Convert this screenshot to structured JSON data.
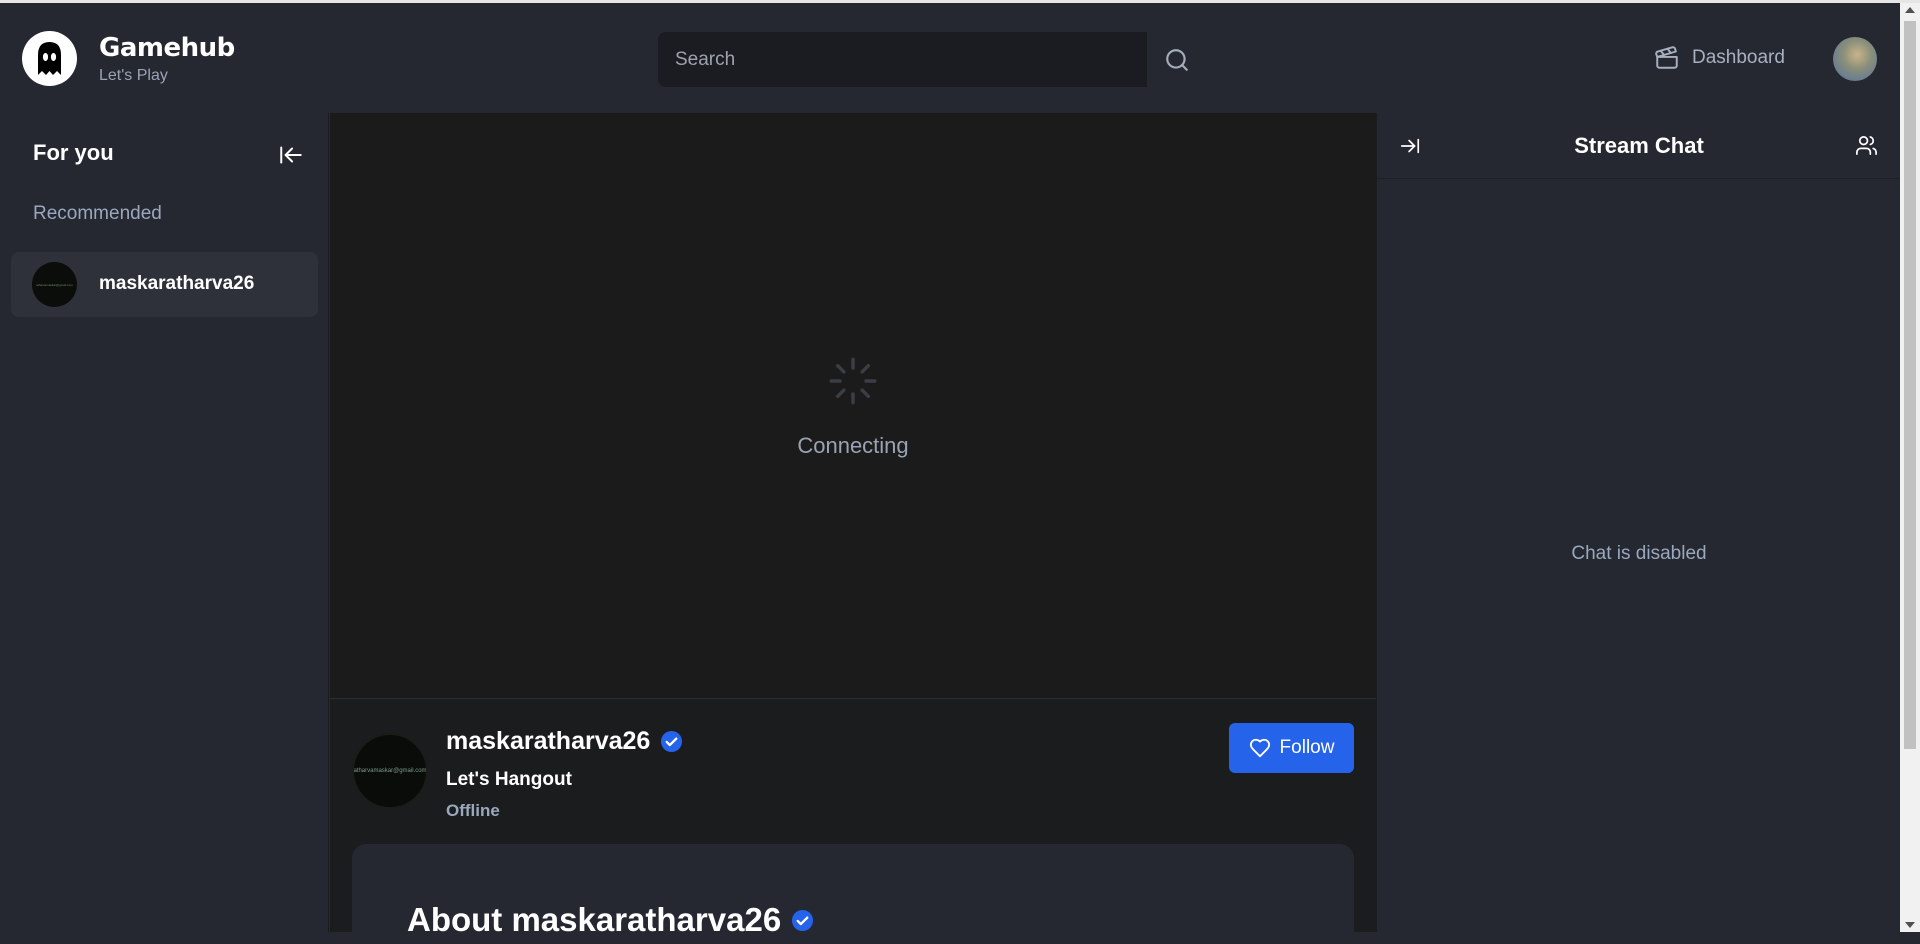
{
  "header": {
    "brand_title": "Gamehub",
    "brand_subtitle": "Let's Play",
    "search_placeholder": "Search",
    "dashboard_label": "Dashboard"
  },
  "sidebar": {
    "heading": "For you",
    "section_label": "Recommended",
    "items": [
      {
        "name": "maskaratharva26",
        "avatar_text": "atharvamaskar@gmail.com"
      }
    ]
  },
  "player": {
    "status_text": "Connecting"
  },
  "stream_info": {
    "username": "maskaratharva26",
    "avatar_text": "atharvamaskar@gmail.com",
    "title": "Let's Hangout",
    "status": "Offline",
    "follow_label": "Follow"
  },
  "about": {
    "title": "About maskaratharva26"
  },
  "chat": {
    "title": "Stream Chat",
    "disabled_text": "Chat is disabled"
  },
  "colors": {
    "background": "#252731",
    "player_background": "#1b1b1c",
    "accent_blue": "#2563eb",
    "muted_text": "#9aa8bd"
  },
  "icons": [
    "ghost-logo-icon",
    "search-icon",
    "clapperboard-icon",
    "collapse-left-icon",
    "spinner-icon",
    "verified-icon",
    "heart-icon",
    "expand-right-icon",
    "users-icon"
  ]
}
